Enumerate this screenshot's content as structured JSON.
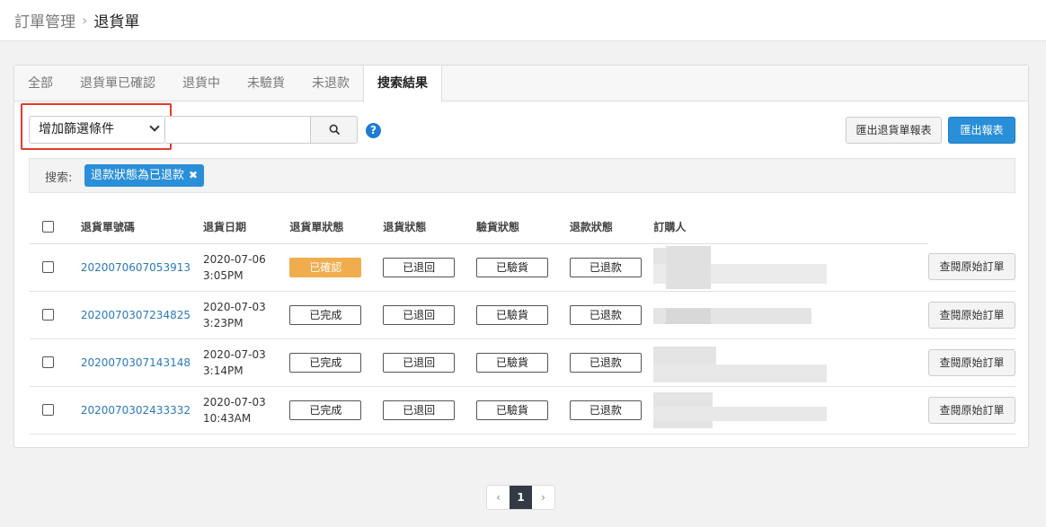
{
  "breadcrumb": {
    "root": "訂單管理",
    "separator": "›",
    "current": "退貨單"
  },
  "tabs": [
    {
      "label": "全部",
      "active": false
    },
    {
      "label": "退貨單已確認",
      "active": false
    },
    {
      "label": "退貨中",
      "active": false
    },
    {
      "label": "未驗貨",
      "active": false
    },
    {
      "label": "未退款",
      "active": false
    },
    {
      "label": "搜索結果",
      "active": true
    }
  ],
  "filter": {
    "select_value": "增加篩選條件",
    "search_value": "",
    "help": "?"
  },
  "actions": {
    "export_return": "匯出退貨單報表",
    "export": "匯出報表"
  },
  "search": {
    "label": "搜索:",
    "tag": "退款狀態為已退款",
    "tag_remove": "✖"
  },
  "table": {
    "headers": [
      "退貨單號碼",
      "退貨日期",
      "退貨單狀態",
      "退貨狀態",
      "驗貨狀態",
      "退款狀態",
      "訂購人"
    ],
    "view_label": "查閱原始訂單",
    "rows": [
      {
        "number": "2020070607053913",
        "date": "2020-07-06",
        "time": "3:05PM",
        "order_status": "已確認",
        "order_status_color": "#f0ad4e",
        "return_status": "已退回",
        "inspect_status": "已驗貨",
        "refund_status": "已退款"
      },
      {
        "number": "2020070307234825",
        "date": "2020-07-03",
        "time": "3:23PM",
        "order_status": "已完成",
        "order_status_color": "#ffffff",
        "return_status": "已退回",
        "inspect_status": "已驗貨",
        "refund_status": "已退款"
      },
      {
        "number": "2020070307143148",
        "date": "2020-07-03",
        "time": "3:14PM",
        "order_status": "已完成",
        "order_status_color": "#ffffff",
        "return_status": "已退回",
        "inspect_status": "已驗貨",
        "refund_status": "已退款"
      },
      {
        "number": "2020070302433332",
        "date": "2020-07-03",
        "time": "10:43AM",
        "order_status": "已完成",
        "order_status_color": "#ffffff",
        "return_status": "已退回",
        "inspect_status": "已驗貨",
        "refund_status": "已退款"
      }
    ]
  },
  "pagination": {
    "prev": "‹",
    "current": "1",
    "next": "›"
  }
}
